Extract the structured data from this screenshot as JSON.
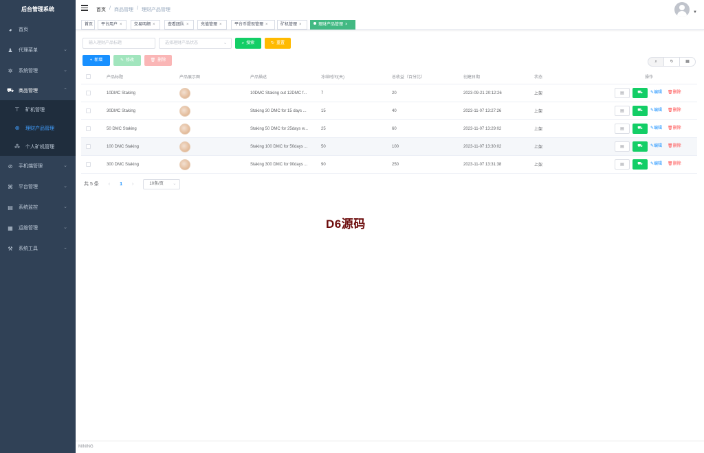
{
  "sidebar": {
    "title": "后台管理系统",
    "items": [
      {
        "label": "首页",
        "icon": "dashboard-icon"
      },
      {
        "label": "代理菜单",
        "icon": "user-group-icon"
      },
      {
        "label": "系统管理",
        "icon": "gear-icon"
      },
      {
        "label": "商品管理",
        "icon": "cart-icon"
      },
      {
        "label": "手机端管理",
        "icon": "mobile-icon"
      },
      {
        "label": "平台管理",
        "icon": "platform-icon"
      },
      {
        "label": "系统监控",
        "icon": "monitor-icon"
      },
      {
        "label": "运维管理",
        "icon": "ops-icon"
      },
      {
        "label": "系统工具",
        "icon": "tool-icon"
      }
    ],
    "subitems": [
      {
        "label": "矿机管理",
        "icon": "pickaxe-icon"
      },
      {
        "label": "理财产品管理",
        "icon": "product-icon"
      },
      {
        "label": "个人矿机管理",
        "icon": "tree-icon"
      }
    ]
  },
  "breadcrumb": [
    "首页",
    "/",
    "商品管理",
    "/",
    "理财产品管理"
  ],
  "tags": [
    {
      "label": "首页",
      "closable": false
    },
    {
      "label": "平台用户",
      "closable": true
    },
    {
      "label": "交易明细",
      "closable": true
    },
    {
      "label": "查看团队",
      "closable": true
    },
    {
      "label": "充值管理",
      "closable": true
    },
    {
      "label": "平台币提现管理",
      "closable": true
    },
    {
      "label": "矿机管理",
      "closable": true
    },
    {
      "label": "理财产品管理",
      "closable": true
    }
  ],
  "filters": {
    "title_placeholder": "输入理财产品标题",
    "status_placeholder": "选择理财产品状态",
    "search_label": "搜索",
    "reset_label": "重置"
  },
  "toolbar": {
    "add_label": "新增",
    "edit_label": "修改",
    "delete_label": "删除"
  },
  "table": {
    "headers": [
      "产品标题",
      "产品展示图",
      "产品描述",
      "冻结时间(天)",
      "总收益（百分比）",
      "创建日期",
      "状态",
      "操作"
    ],
    "rows": [
      {
        "title": "10DMC Staking",
        "desc": "10DMC Staking out 12DMC f...",
        "days": "7",
        "profit": "20",
        "date": "2023-09-21 20:12:26",
        "status": "上架"
      },
      {
        "title": "30DMC Staking",
        "desc": "Staking 30 DMC for 15 days ...",
        "days": "15",
        "profit": "40",
        "date": "2023-11-07 13:27:26",
        "status": "上架"
      },
      {
        "title": "50 DMC Staking",
        "desc": "Staking 50 DMC for 25days w...",
        "days": "25",
        "profit": "60",
        "date": "2023-11-07 13:29:02",
        "status": "上架"
      },
      {
        "title": "100 DMC Staking",
        "desc": "Staking 100 DMC for 50days ...",
        "days": "50",
        "profit": "100",
        "date": "2023-11-07 13:30:02",
        "status": "上架"
      },
      {
        "title": "300 DMC Staking",
        "desc": "Staking 300 DMC for 90days ...",
        "days": "90",
        "profit": "250",
        "date": "2023-11-07 13:31:38",
        "status": "上架"
      }
    ],
    "row_edit_label": "编辑",
    "row_delete_label": "删除"
  },
  "pagination": {
    "total": "共 5 条",
    "current_page": "1",
    "page_size": "10条/页"
  },
  "watermark": "D6源码",
  "footer": "MINING",
  "colors": {
    "sidebar_bg": "#304156",
    "active_blue": "#409eff",
    "tag_active": "#42b983",
    "success_green": "#13ce66",
    "warning_yellow": "#ffba00",
    "danger_red": "#ff4949"
  }
}
